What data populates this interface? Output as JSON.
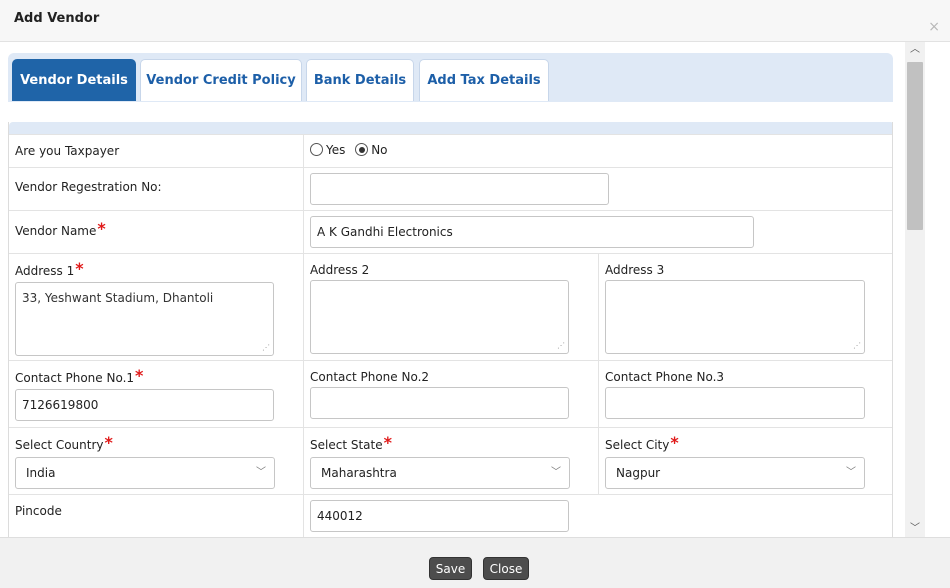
{
  "dialog": {
    "title": "Add Vendor",
    "close_glyph": "×"
  },
  "tabs": [
    {
      "label": "Vendor Details",
      "active": true
    },
    {
      "label": "Vendor Credit Policy",
      "active": false
    },
    {
      "label": "Bank Details",
      "active": false
    },
    {
      "label": "Add Tax Details",
      "active": false
    }
  ],
  "form": {
    "taxpayer": {
      "label": "Are you Taxpayer",
      "options": [
        "Yes",
        "No"
      ],
      "selected": "No"
    },
    "registration_no": {
      "label": "Vendor Regestration No:",
      "value": ""
    },
    "vendor_name": {
      "label": "Vendor Name",
      "value": "A K Gandhi Electronics"
    },
    "address1": {
      "label": "Address 1",
      "value": "33, Yeshwant Stadium, Dhantoli"
    },
    "address2": {
      "label": "Address 2",
      "value": ""
    },
    "address3": {
      "label": "Address 3",
      "value": ""
    },
    "phone1": {
      "label": "Contact Phone No.1",
      "value": "7126619800"
    },
    "phone2": {
      "label": "Contact Phone No.2",
      "value": ""
    },
    "phone3": {
      "label": "Contact Phone No.3",
      "value": ""
    },
    "country": {
      "label": "Select Country",
      "value": "India"
    },
    "state": {
      "label": "Select State",
      "value": "Maharashtra"
    },
    "city": {
      "label": "Select City",
      "value": "Nagpur"
    },
    "pincode": {
      "label": "Pincode",
      "value": "440012"
    },
    "required_mark": "*"
  },
  "footer": {
    "save_label": "Save",
    "close_label": "Close"
  },
  "icons": {
    "scroll_up": "up-chevron-icon",
    "scroll_down": "down-chevron-icon",
    "select_chevron": "chevron-down-icon",
    "resize": "resize-grip-icon"
  },
  "colors": {
    "active_tab": "#1f64a8",
    "tab_text": "#1d5fa8",
    "required": "#e01a1a",
    "tabbar_bg": "#dfe9f6"
  }
}
